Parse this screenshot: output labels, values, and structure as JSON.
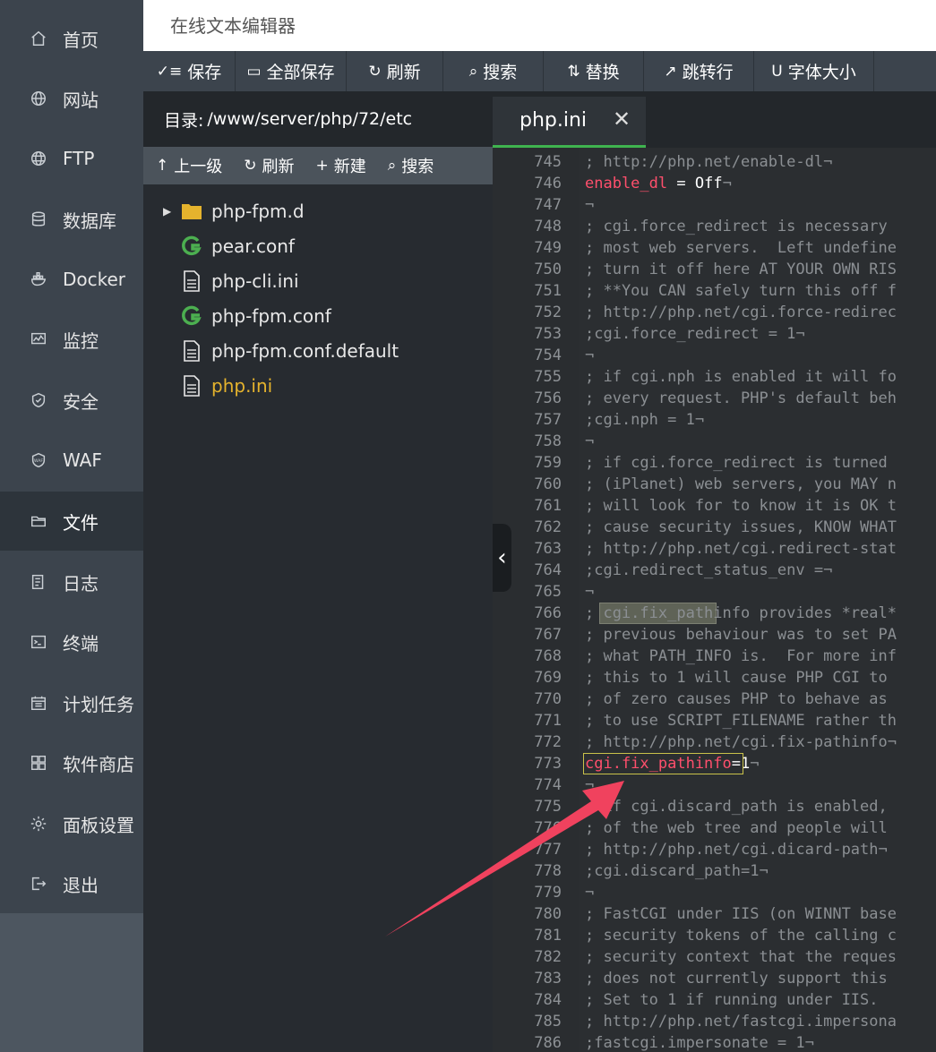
{
  "nav": [
    {
      "label": "首页",
      "icon": "home-icon"
    },
    {
      "label": "网站",
      "icon": "globe-icon"
    },
    {
      "label": "FTP",
      "icon": "ftp-globe-icon"
    },
    {
      "label": "数据库",
      "icon": "database-icon"
    },
    {
      "label": "Docker",
      "icon": "docker-icon"
    },
    {
      "label": "监控",
      "icon": "monitor-icon"
    },
    {
      "label": "安全",
      "icon": "shield-icon"
    },
    {
      "label": "WAF",
      "icon": "waf-shield-icon"
    },
    {
      "label": "文件",
      "icon": "folder-icon",
      "active": true
    },
    {
      "label": "日志",
      "icon": "log-icon"
    },
    {
      "label": "终端",
      "icon": "terminal-icon"
    },
    {
      "label": "计划任务",
      "icon": "calendar-icon"
    },
    {
      "label": "软件商店",
      "icon": "grid-icon"
    },
    {
      "label": "面板设置",
      "icon": "gear-icon"
    },
    {
      "label": "退出",
      "icon": "logout-icon"
    }
  ],
  "title": "在线文本编辑器",
  "toolbar": [
    {
      "label": "保存",
      "icon": "save-icon"
    },
    {
      "label": "全部保存",
      "icon": "save-all-icon"
    },
    {
      "label": "刷新",
      "icon": "refresh-icon"
    },
    {
      "label": "搜索",
      "icon": "search-icon"
    },
    {
      "label": "替换",
      "icon": "replace-icon"
    },
    {
      "label": "跳转行",
      "icon": "goto-line-icon"
    },
    {
      "label": "字体大小",
      "icon": "font-size-icon"
    }
  ],
  "directory": {
    "label": "目录:",
    "path": "/www/server/php/72/etc"
  },
  "file_tools": [
    {
      "label": "上一级",
      "icon": "up-arrow-icon"
    },
    {
      "label": "刷新",
      "icon": "refresh-icon"
    },
    {
      "label": "新建",
      "icon": "plus-icon"
    },
    {
      "label": "搜索",
      "icon": "search-icon"
    }
  ],
  "files": [
    {
      "name": "php-fpm.d",
      "type": "folder"
    },
    {
      "name": "pear.conf",
      "type": "conf"
    },
    {
      "name": "php-cli.ini",
      "type": "ini"
    },
    {
      "name": "php-fpm.conf",
      "type": "conf"
    },
    {
      "name": "php-fpm.conf.default",
      "type": "ini"
    },
    {
      "name": "php.ini",
      "type": "ini",
      "active": true
    }
  ],
  "tab": {
    "name": "php.ini",
    "close": "✕"
  },
  "colors": {
    "accent": "#3fb34f",
    "sidebar": "#3c444d",
    "key": "#ff4f6c",
    "comment": "#8b8f93",
    "active_file": "#e5b32d",
    "arrow": "#f0425e"
  },
  "editor": {
    "current_line": 766,
    "lines": [
      {
        "n": "745",
        "text": "; http://php.net/enable-dl¬"
      },
      {
        "n": "746",
        "k": "enable_dl",
        "eq": " = ",
        "v": "Off",
        "tail": "¬"
      },
      {
        "n": "747",
        "text": "¬"
      },
      {
        "n": "748",
        "text": "; cgi.force_redirect is necessary"
      },
      {
        "n": "749",
        "text": "; most web servers.  Left undefine"
      },
      {
        "n": "750",
        "text": "; turn it off here AT YOUR OWN RIS"
      },
      {
        "n": "751",
        "text": "; **You CAN safely turn this off f"
      },
      {
        "n": "752",
        "text": "; http://php.net/cgi.force-redirec"
      },
      {
        "n": "753",
        "text": ";cgi.force_redirect = 1¬"
      },
      {
        "n": "754",
        "text": "¬"
      },
      {
        "n": "755",
        "text": "; if cgi.nph is enabled it will fo"
      },
      {
        "n": "756",
        "text": "; every request. PHP's default beh"
      },
      {
        "n": "757",
        "text": ";cgi.nph = 1¬"
      },
      {
        "n": "758",
        "text": "¬"
      },
      {
        "n": "759",
        "text": "; if cgi.force_redirect is turned"
      },
      {
        "n": "760",
        "text": "; (iPlanet) web servers, you MAY n"
      },
      {
        "n": "761",
        "text": "; will look for to know it is OK t"
      },
      {
        "n": "762",
        "text": "; cause security issues, KNOW WHAT"
      },
      {
        "n": "763",
        "text": "; http://php.net/cgi.redirect-stat"
      },
      {
        "n": "764",
        "text": ";cgi.redirect_status_env =¬"
      },
      {
        "n": "765",
        "text": "¬"
      },
      {
        "n": "766",
        "text": "; cgi.fix_pathinfo provides *real*"
      },
      {
        "n": "767",
        "text": "; previous behaviour was to set PA"
      },
      {
        "n": "768",
        "text": "; what PATH_INFO is.  For more inf"
      },
      {
        "n": "769",
        "text": "; this to 1 will cause PHP CGI to"
      },
      {
        "n": "770",
        "text": "; of zero causes PHP to behave as"
      },
      {
        "n": "771",
        "text": "; to use SCRIPT_FILENAME rather th"
      },
      {
        "n": "772",
        "text": "; http://php.net/cgi.fix-pathinfo¬"
      },
      {
        "n": "773",
        "k": "cgi.fix_pathinfo",
        "eq": "=",
        "v": "1",
        "tail": "¬"
      },
      {
        "n": "774",
        "text": "¬"
      },
      {
        "n": "775",
        "text": "; if cgi.discard_path is enabled,"
      },
      {
        "n": "776",
        "text": "; of the web tree and people will"
      },
      {
        "n": "777",
        "text": "; http://php.net/cgi.dicard-path¬"
      },
      {
        "n": "778",
        "text": ";cgi.discard_path=1¬"
      },
      {
        "n": "779",
        "text": "¬"
      },
      {
        "n": "780",
        "text": "; FastCGI under IIS (on WINNT base"
      },
      {
        "n": "781",
        "text": "; security tokens of the calling c"
      },
      {
        "n": "782",
        "text": "; security context that the reques"
      },
      {
        "n": "783",
        "text": "; does not currently support this"
      },
      {
        "n": "784",
        "text": "; Set to 1 if running under IIS.  "
      },
      {
        "n": "785",
        "text": "; http://php.net/fastcgi.impersona"
      },
      {
        "n": "786",
        "text": ";fastcgi.impersonate = 1¬"
      }
    ]
  }
}
